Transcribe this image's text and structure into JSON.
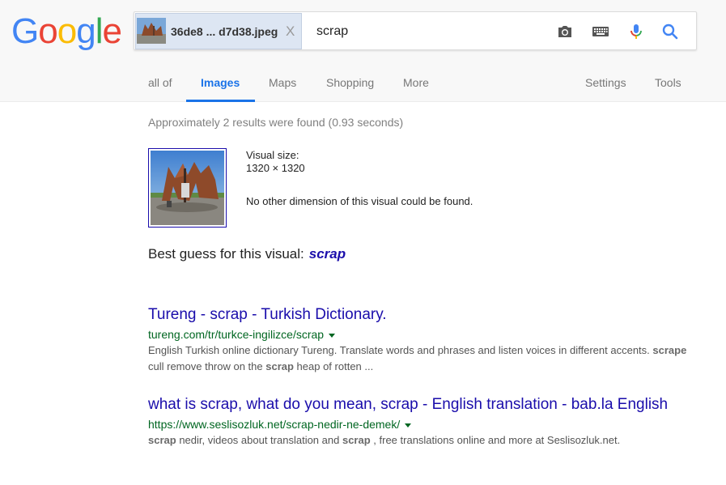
{
  "logo": {
    "text": "Google",
    "letters": [
      {
        "char": "G",
        "color": "#4285F4"
      },
      {
        "char": "o",
        "color": "#EA4335"
      },
      {
        "char": "o",
        "color": "#FBBC05"
      },
      {
        "char": "g",
        "color": "#4285F4"
      },
      {
        "char": "l",
        "color": "#34A853"
      },
      {
        "char": "e",
        "color": "#EA4335"
      }
    ]
  },
  "search": {
    "image_chip_name": "36de8 ... d7d38.jpeg",
    "image_chip_close": "X",
    "query": "scrap",
    "icons": [
      "camera-icon",
      "keyboard-icon",
      "microphone-icon",
      "search-icon"
    ]
  },
  "tabs": {
    "items": [
      {
        "label": "all of",
        "active": false
      },
      {
        "label": "Images",
        "active": true
      },
      {
        "label": "Maps",
        "active": false
      },
      {
        "label": "Shopping",
        "active": false
      },
      {
        "label": "More",
        "active": false
      }
    ],
    "settings": "Settings",
    "tools": "Tools"
  },
  "stats": "Approximately 2 results were found (0.93 seconds)",
  "visual": {
    "size_label": "Visual size:",
    "size_value": "1320 × 1320",
    "no_other": "No other dimension of this visual could be found."
  },
  "best_guess": {
    "label": "Best guess for this visual:",
    "value": "scrap"
  },
  "results": [
    {
      "title": "Tureng - scrap - Turkish Dictionary.",
      "url": "tureng.com/tr/turkce-ingilizce/scrap",
      "snippet_parts": [
        {
          "text": "English Turkish online dictionary Tureng. Translate words and phrases and listen voices in different accents. ",
          "bold": false
        },
        {
          "text": "scrape",
          "bold": true
        },
        {
          "text": " cull remove throw on the ",
          "bold": false
        },
        {
          "text": "scrap",
          "bold": true
        },
        {
          "text": " heap of rotten ...",
          "bold": false
        }
      ]
    },
    {
      "title": "what is scrap, what do you mean, scrap - English translation - bab.la English",
      "url": "https://www.seslisozluk.net/scrap-nedir-ne-demek/",
      "snippet_parts": [
        {
          "text": "scrap",
          "bold": true
        },
        {
          "text": " nedir, videos about translation and ",
          "bold": false
        },
        {
          "text": "scrap",
          "bold": true
        },
        {
          "text": " , free translations online and more at Seslisozluk.net.",
          "bold": false
        }
      ]
    }
  ],
  "colors": {
    "link": "#1a0dab",
    "url": "#006621",
    "active_tab": "#1a73e8"
  }
}
